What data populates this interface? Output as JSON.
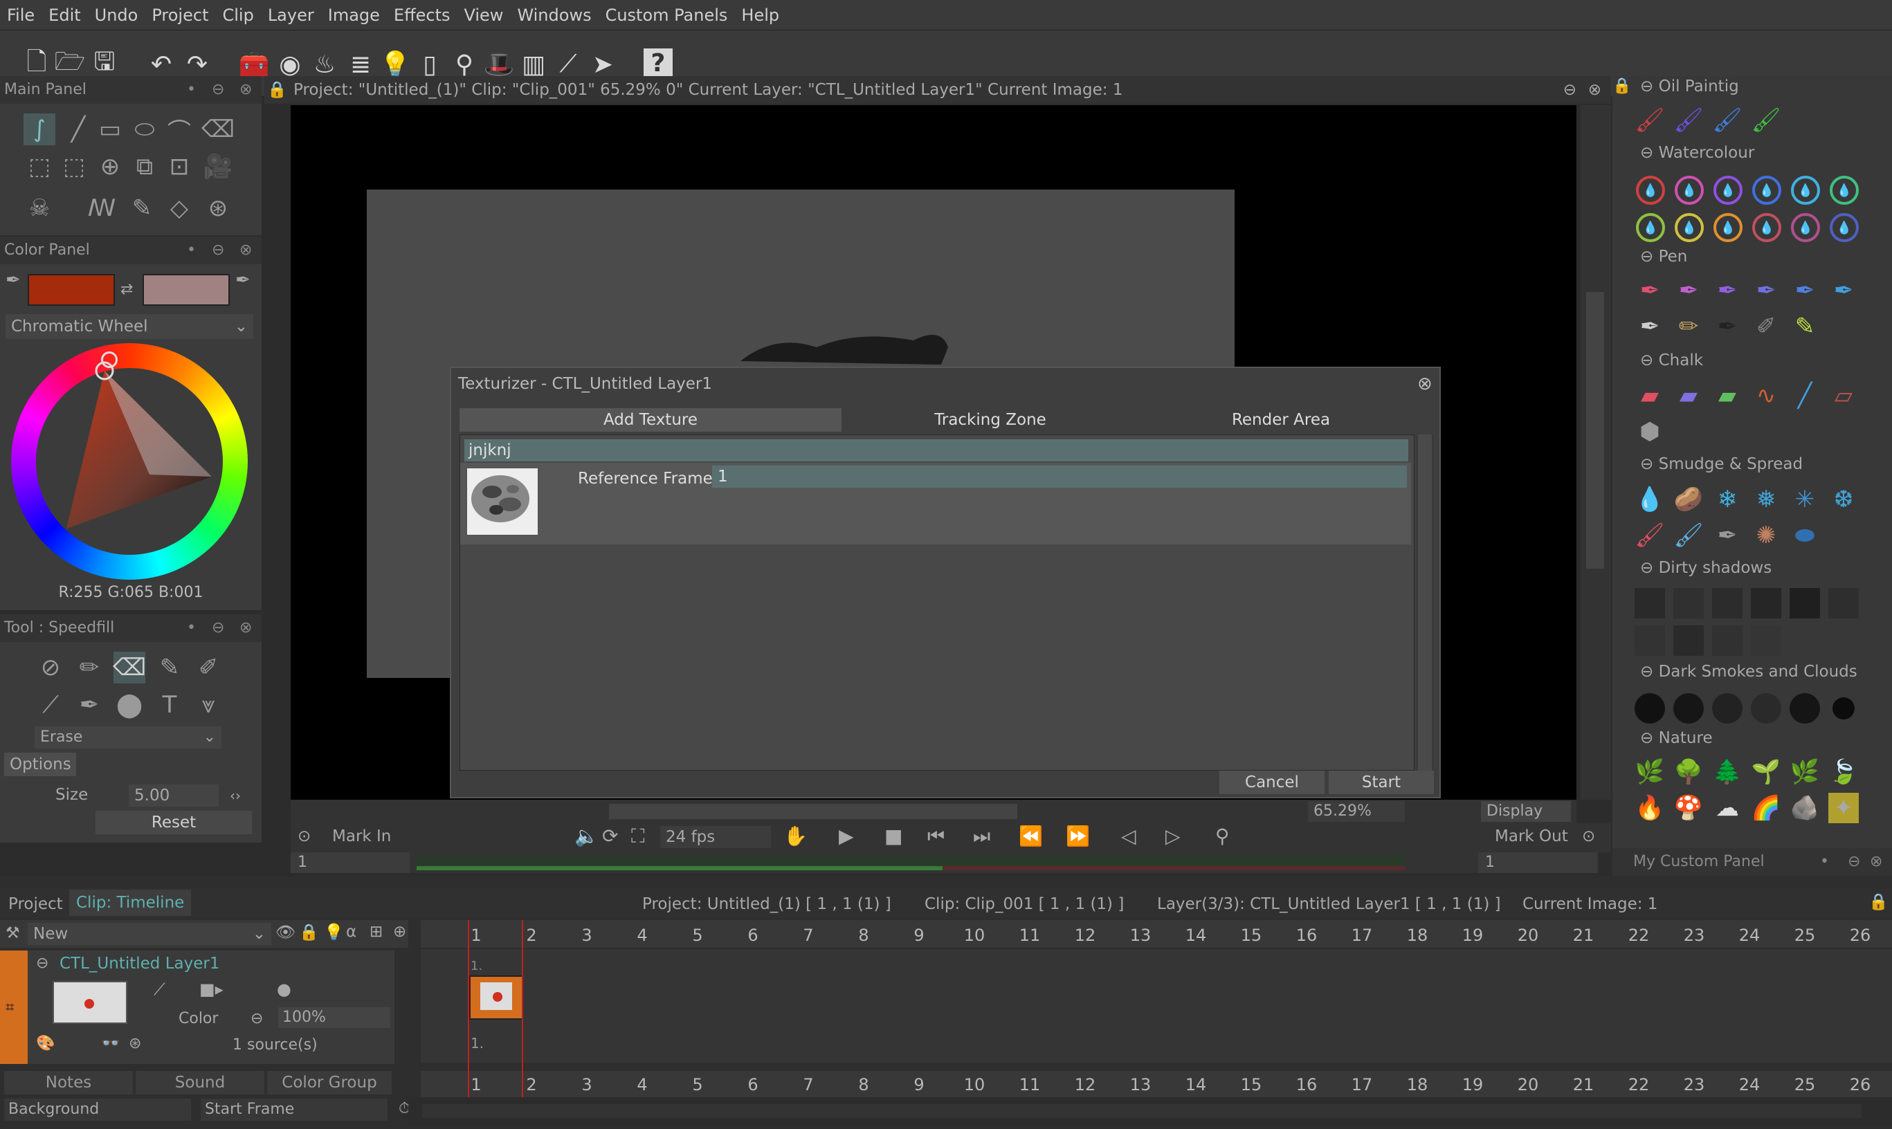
{
  "menu": [
    "File",
    "Edit",
    "Undo",
    "Project",
    "Clip",
    "Layer",
    "Image",
    "Effects",
    "View",
    "Windows",
    "Custom Panels",
    "Help"
  ],
  "main_panel": {
    "title": "Main Panel"
  },
  "color_panel": {
    "title": "Color Panel",
    "mode": "Chromatic Wheel",
    "rgb": "R:255 G:065 B:001",
    "fg_color": "#a42b0b",
    "bg_color": "#a08282"
  },
  "tool_panel": {
    "title": "Tool : Speedfill",
    "mode": "Erase",
    "options": "Options",
    "size_label": "Size",
    "size_value": "5.00",
    "reset": "Reset"
  },
  "viewer": {
    "status": "Project:  \"Untitled_(1)\"  Clip: \"Clip_001\"   65.29%   0\"  Current Layer: \"CTL_Untitled Layer1\"  Current Image: 1",
    "zoom": "65.29%",
    "display": "Display",
    "mark_in": "Mark In",
    "mark_out": "Mark Out",
    "fps": "24 fps",
    "frame_in": "1",
    "frame_out": "1"
  },
  "dialog": {
    "title": "Texturizer - CTL_Untitled Layer1",
    "tabs": [
      "Add Texture",
      "Tracking Zone",
      "Render Area"
    ],
    "texture_name": "jnjknj",
    "ref_label": "Reference Frame",
    "ref_value": "1",
    "cancel": "Cancel",
    "start": "Start"
  },
  "brushes": {
    "groups": [
      "Oil Paintig",
      "Watercolour",
      "Pen",
      "Chalk",
      "Smudge & Spread",
      "Dirty shadows",
      "Dark Smokes and Clouds",
      "Nature"
    ],
    "custom_panel": "My Custom Panel"
  },
  "timeline": {
    "tab_project": "Project",
    "tab_clip": "Clip: Timeline",
    "info_project": "Project: Untitled_(1) [ 1 , 1  (1) ]",
    "info_clip": "Clip: Clip_001 [ 1 , 1  (1) ]",
    "info_layer": "Layer(3/3): CTL_Untitled Layer1 [ 1 , 1  (1) ]",
    "info_image": "Current Image: 1",
    "new_label": "New",
    "layer_name": "CTL_Untitled Layer1",
    "color_label": "Color",
    "opacity": "100%",
    "sources": "1 source(s)",
    "notes": "Notes",
    "sound": "Sound",
    "color_group": "Color Group",
    "background": "Background",
    "start_frame": "Start Frame",
    "cell_label_top": "1.",
    "cell_label_bottom": "1.",
    "frames": [
      "1",
      "2",
      "3",
      "4",
      "5",
      "6",
      "7",
      "8",
      "9",
      "10",
      "11",
      "12",
      "13",
      "14",
      "15",
      "16",
      "17",
      "18",
      "19",
      "20",
      "21",
      "22",
      "23",
      "24",
      "25",
      "26"
    ]
  }
}
